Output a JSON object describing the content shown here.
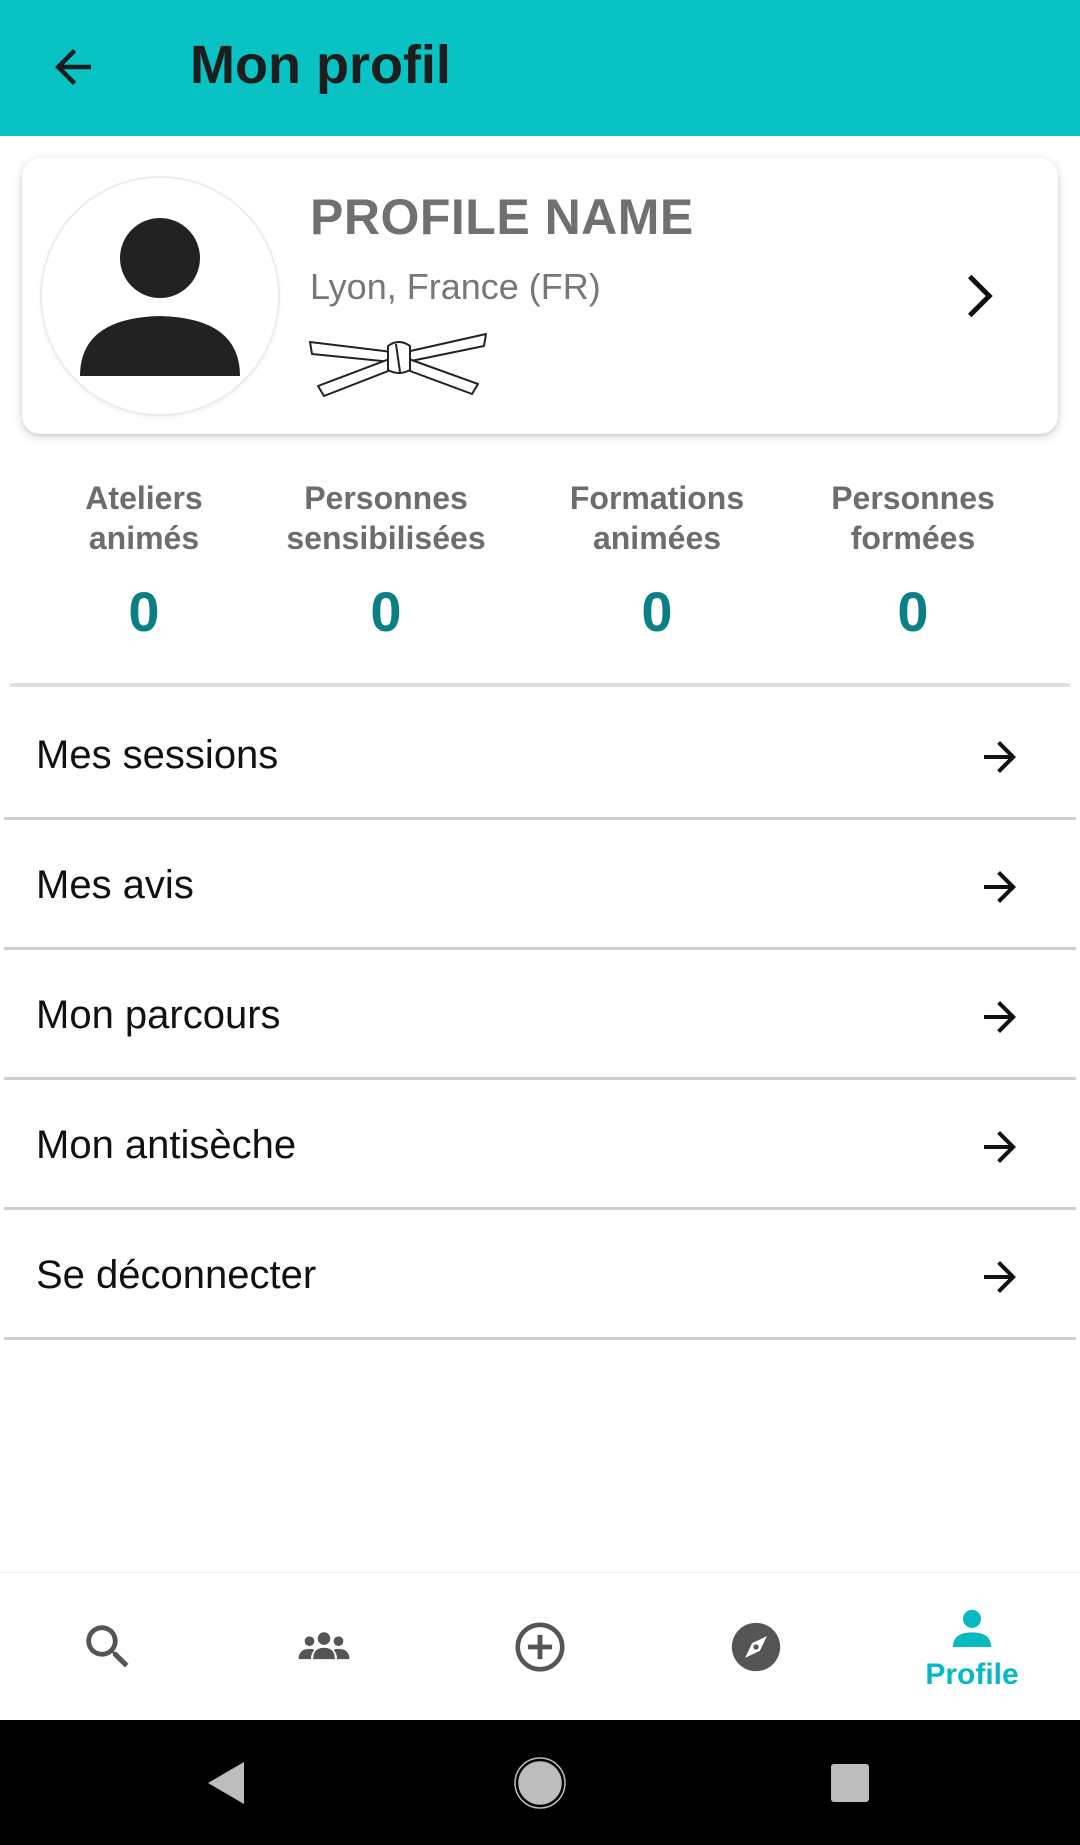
{
  "header": {
    "title": "Mon profil"
  },
  "profile": {
    "name": "PROFILE NAME",
    "location": "Lyon, France (FR)"
  },
  "stats": [
    {
      "label_line1": "Ateliers",
      "label_line2": "animés",
      "value": "0"
    },
    {
      "label_line1": "Personnes",
      "label_line2": "sensibilisées",
      "value": "0"
    },
    {
      "label_line1": "Formations",
      "label_line2": "animées",
      "value": "0"
    },
    {
      "label_line1": "Personnes",
      "label_line2": "formées",
      "value": "0"
    }
  ],
  "menu": [
    {
      "label": "Mes sessions"
    },
    {
      "label": "Mes avis"
    },
    {
      "label": "Mon parcours"
    },
    {
      "label": "Mon antisèche"
    },
    {
      "label": "Se déconnecter"
    }
  ],
  "bottom_nav": {
    "items": [
      {
        "icon": "search-icon"
      },
      {
        "icon": "group-icon"
      },
      {
        "icon": "add-circle-icon"
      },
      {
        "icon": "compass-icon"
      },
      {
        "icon": "person-icon",
        "label": "Profile",
        "active": true
      }
    ]
  },
  "colors": {
    "appbar": "#08c2c4",
    "stat_value": "#0a7f84",
    "active_nav": "#08b9bf"
  }
}
